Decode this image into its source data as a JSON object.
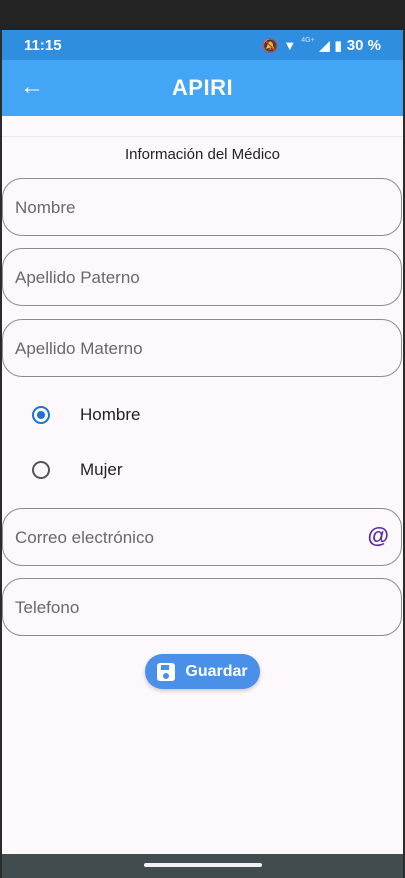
{
  "status_bar": {
    "time": "11:15",
    "network": "4G+",
    "battery": "30 %"
  },
  "app_bar": {
    "title": "APIRI",
    "back_icon": "arrow-left-icon"
  },
  "form": {
    "section_title": "Información del Médico",
    "fields": {
      "nombre": {
        "placeholder": "Nombre",
        "value": ""
      },
      "apellido_paterno": {
        "placeholder": "Apellido Paterno",
        "value": ""
      },
      "apellido_materno": {
        "placeholder": "Apellido Materno",
        "value": ""
      },
      "correo": {
        "placeholder": "Correo electrónico",
        "value": "",
        "icon": "at-icon"
      },
      "telefono": {
        "placeholder": "Telefono",
        "value": ""
      }
    },
    "gender": {
      "options": [
        "Hombre",
        "Mujer"
      ],
      "selected": "Hombre"
    },
    "save_label": "Guardar"
  },
  "colors": {
    "status_bar": "#2f8ee0",
    "app_bar": "#42a5f5",
    "radio_selected": "#1976d2",
    "save_button": "#4a8fe8",
    "at_icon": "#5a2ca0"
  }
}
